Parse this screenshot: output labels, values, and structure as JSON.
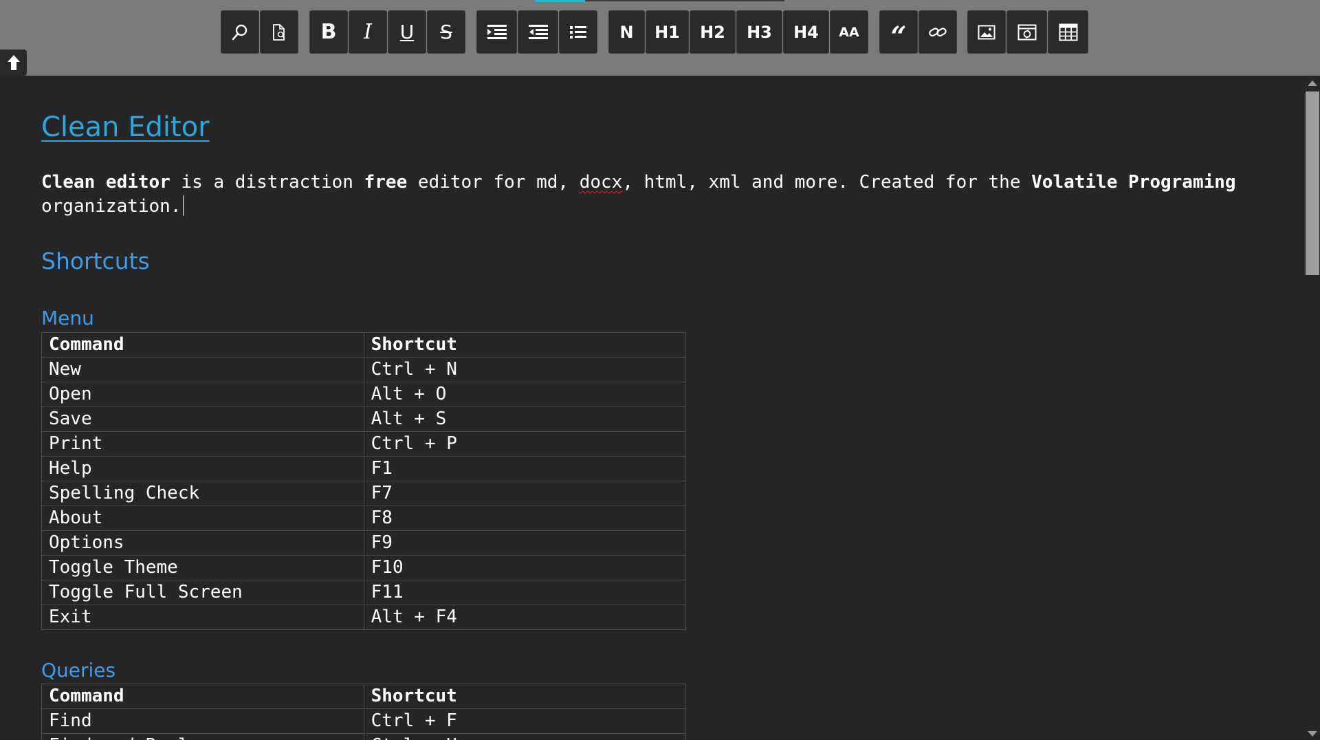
{
  "toolbar": {
    "buttons": {
      "normal": "N",
      "h1": "H1",
      "h2": "H2",
      "h3": "H3",
      "h4": "H4",
      "font_size": "AA",
      "bold": "B",
      "italic": "I",
      "underline": "U",
      "strike": "S",
      "quote": "“"
    },
    "icons": {
      "search": "search-icon",
      "preview": "document-preview-icon",
      "indent": "indent-icon",
      "outdent": "outdent-icon",
      "list": "bulleted-list-icon",
      "link": "link-icon",
      "image": "image-icon",
      "media": "embed-icon",
      "table": "table-icon"
    },
    "colors": {
      "toolbar_bg": "#7b7b7b",
      "button_bg": "#2a2a2a",
      "accent": "#29b6c8"
    }
  },
  "document": {
    "title": "Clean Editor",
    "intro": {
      "p1_bold": "Clean editor",
      "p2": " is a distraction ",
      "p3_bold": "free",
      "p4": " editor for md, ",
      "p5_misspelled": "docx",
      "p6": ", html, xml and more. Created for the ",
      "p7_bold": "Volatile Programing",
      "p8": " organization."
    },
    "section_title": "Shortcuts",
    "menu": {
      "title": "Menu",
      "headers": [
        "Command",
        "Shortcut"
      ],
      "rows": [
        [
          "New",
          "Ctrl + N"
        ],
        [
          "Open",
          "Alt + O"
        ],
        [
          "Save",
          "Alt + S"
        ],
        [
          "Print",
          "Ctrl + P"
        ],
        [
          "Help",
          "F1"
        ],
        [
          "Spelling Check",
          "F7"
        ],
        [
          "About",
          "F8"
        ],
        [
          "Options",
          "F9"
        ],
        [
          "Toggle Theme",
          "F10"
        ],
        [
          "Toggle Full Screen",
          "F11"
        ],
        [
          "Exit",
          "Alt + F4"
        ]
      ]
    },
    "queries": {
      "title": "Queries",
      "headers": [
        "Command",
        "Shortcut"
      ],
      "rows": [
        [
          "Find",
          "Ctrl + F"
        ],
        [
          "Find and Replace",
          "Ctrl + H"
        ]
      ]
    },
    "colors": {
      "background": "#262626",
      "title": "#2aa7e0",
      "heading": "#3d9be9",
      "spell_error": "#e02020"
    }
  }
}
